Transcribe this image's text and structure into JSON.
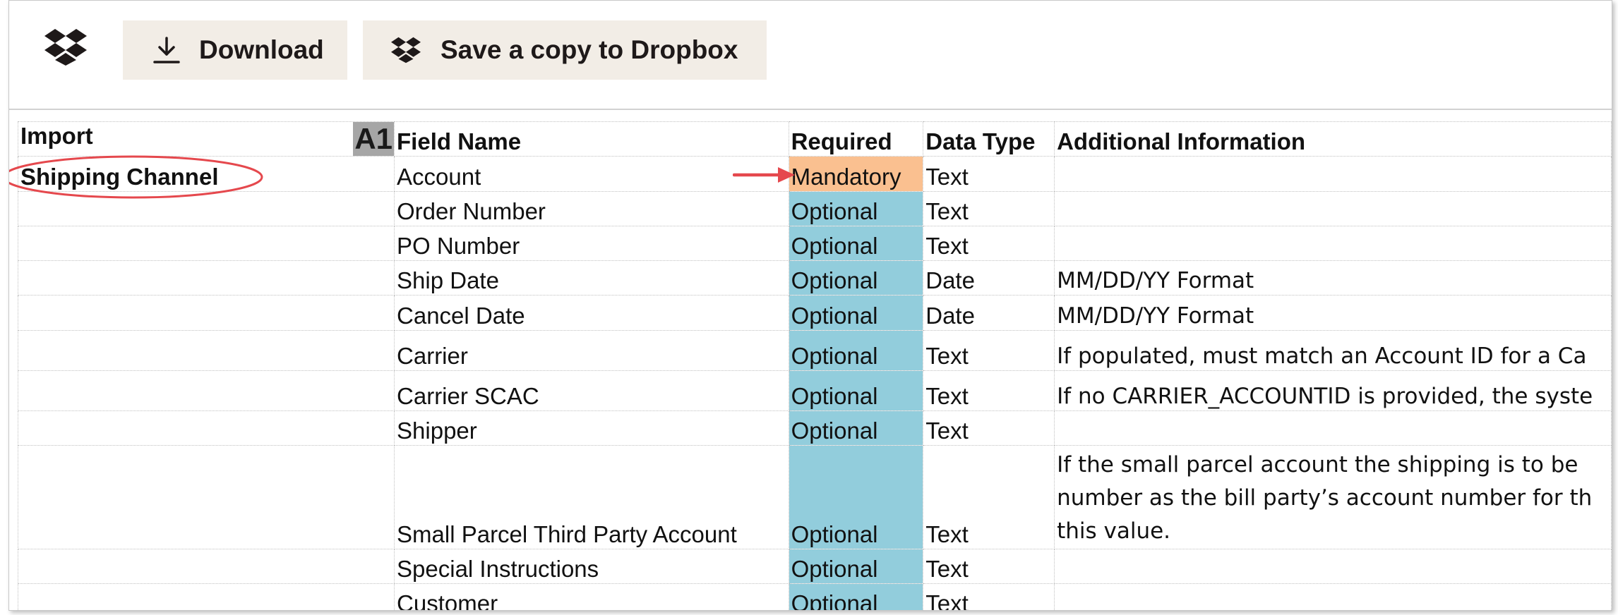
{
  "toolbar": {
    "logo_icon": "dropbox-logo-icon",
    "download_label": "Download",
    "download_icon": "download-icon",
    "save_label": "Save a copy to Dropbox",
    "save_icon": "dropbox-icon"
  },
  "sheet": {
    "cell_ref": "A1",
    "headers": {
      "import": "Import",
      "field_name": "Field Name",
      "required": "Required",
      "data_type": "Data Type",
      "additional_info": "Additional Information"
    },
    "import_value": "Shipping Channel",
    "rows": [
      {
        "field": "Account",
        "required": "Mandatory",
        "type": "Text",
        "info": ""
      },
      {
        "field": "Order Number",
        "required": "Optional",
        "type": "Text",
        "info": ""
      },
      {
        "field": "PO Number",
        "required": "Optional",
        "type": "Text",
        "info": ""
      },
      {
        "field": "Ship Date",
        "required": "Optional",
        "type": "Date",
        "info": "MM/DD/YY Format"
      },
      {
        "field": "Cancel Date",
        "required": "Optional",
        "type": "Date",
        "info": "MM/DD/YY Format"
      },
      {
        "field": "Carrier",
        "required": "Optional",
        "type": "Text",
        "info": "If populated, must match an Account ID for a Ca"
      },
      {
        "field": "Carrier SCAC",
        "required": "Optional",
        "type": "Text",
        "info": "If no CARRIER_ACCOUNTID is provided, the syste"
      },
      {
        "field": "Shipper",
        "required": "Optional",
        "type": "Text",
        "info": ""
      },
      {
        "field": "Small Parcel Third Party Account",
        "required": "Optional",
        "type": "Text",
        "info": "If the small parcel account the shipping is to be number as the bill party’s account number for th this value."
      },
      {
        "field": "Special Instructions",
        "required": "Optional",
        "type": "Text",
        "info": ""
      },
      {
        "field": "Customer",
        "required": "Optional",
        "type": "Text",
        "info": ""
      }
    ]
  },
  "colors": {
    "optional_fill": "#92cddc",
    "mandatory_fill": "#fac090",
    "annotation_red": "#e5484d",
    "button_bg": "#f2ede6"
  }
}
